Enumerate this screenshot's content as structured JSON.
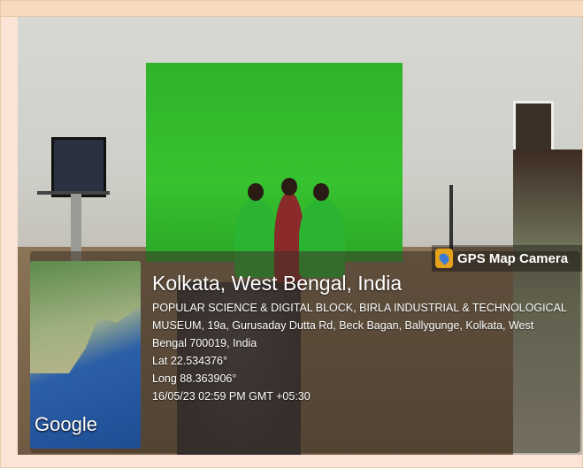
{
  "overlay": {
    "badge_label": "GPS Map Camera",
    "city": "Kolkata, West Bengal, India",
    "address_line1": "POPULAR SCIENCE & DIGITAL BLOCK, BIRLA INDUSTRIAL & TECHNOLOGICAL",
    "address_line2": "MUSEUM, 19a, Gurusaday Dutta Rd, Beck Bagan, Ballygunge, Kolkata, West",
    "address_line3": "Bengal 700019, India",
    "lat": "Lat 22.534376°",
    "long": "Long 88.363906°",
    "timestamp": "16/05/23 02:59 PM GMT +05:30",
    "map_label": "Google"
  },
  "colors": {
    "page_background": "#fbe4d5",
    "green_screen": "#33bb2d"
  },
  "icons": {
    "badge": "gps-map-camera-icon"
  }
}
